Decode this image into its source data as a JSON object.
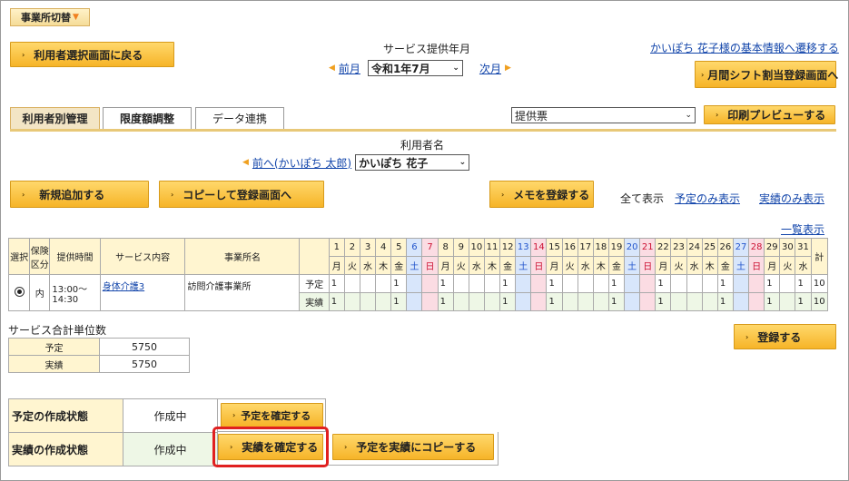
{
  "top": {
    "office_switch": "事業所切替"
  },
  "nav": {
    "back_button": "利用者選択画面に戻る",
    "year_month_label": "サービス提供年月",
    "prev_month": "前月",
    "next_month": "次月",
    "selected_month": "令和1年7月",
    "basic_info_link": "かいぽち 花子様の基本情報へ遷移する",
    "shift_button": "月間シフト割当登録画面へ"
  },
  "tabs": [
    {
      "label": "利用者別管理"
    },
    {
      "label": "限度額調整"
    },
    {
      "label": "データ連携"
    }
  ],
  "print": {
    "selected": "提供票",
    "preview_button": "印刷プレビューする"
  },
  "user": {
    "label": "利用者名",
    "prev_link": "前へ(かいぽち 太郎)",
    "selected": "かいぽち 花子"
  },
  "actions": {
    "new_button": "新規追加する",
    "copy_button": "コピーして登録画面へ",
    "memo_button": "メモを登録する",
    "show_all": "全て表示",
    "show_plan": "予定のみ表示",
    "show_actual": "実績のみ表示",
    "list_link": "一覧表示"
  },
  "table": {
    "headers": {
      "select": "選択",
      "insurance": "保険区分",
      "time": "提供時間",
      "service": "サービス内容",
      "office": "事業所名",
      "total": "計"
    },
    "days": [
      "1",
      "2",
      "3",
      "4",
      "5",
      "6",
      "7",
      "8",
      "9",
      "10",
      "11",
      "12",
      "13",
      "14",
      "15",
      "16",
      "17",
      "18",
      "19",
      "20",
      "21",
      "22",
      "23",
      "24",
      "25",
      "26",
      "27",
      "28",
      "29",
      "30",
      "31"
    ],
    "weekdays": [
      "月",
      "火",
      "水",
      "木",
      "金",
      "土",
      "日",
      "月",
      "火",
      "水",
      "木",
      "金",
      "土",
      "日",
      "月",
      "火",
      "水",
      "木",
      "金",
      "土",
      "日",
      "月",
      "火",
      "水",
      "木",
      "金",
      "土",
      "日",
      "月",
      "火",
      "水"
    ],
    "row": {
      "insurance": "内",
      "time": "13:00〜 14:30",
      "service": "身体介護3",
      "office": "訪問介護事業所",
      "plan_label": "予定",
      "actual_label": "実績",
      "plan": [
        "1",
        "",
        "",
        "",
        "1",
        "",
        "",
        "1",
        "",
        "",
        "",
        "1",
        "",
        "",
        "1",
        "",
        "",
        "",
        "1",
        "",
        "",
        "1",
        "",
        "",
        "",
        "1",
        "",
        "",
        "1",
        "",
        "1"
      ],
      "actual": [
        "1",
        "",
        "",
        "",
        "1",
        "",
        "",
        "1",
        "",
        "",
        "",
        "1",
        "",
        "",
        "1",
        "",
        "",
        "",
        "1",
        "",
        "",
        "1",
        "",
        "",
        "",
        "1",
        "",
        "",
        "1",
        "",
        "1"
      ],
      "plan_total": "10",
      "actual_total": "10"
    }
  },
  "summary": {
    "title": "サービス合計単位数",
    "plan_label": "予定",
    "plan_value": "5750",
    "actual_label": "実績",
    "actual_value": "5750"
  },
  "register_button": "登録する",
  "status": {
    "plan_label": "予定の作成状態",
    "plan_value": "作成中",
    "plan_button": "予定を確定する",
    "actual_label": "実績の作成状態",
    "actual_value": "作成中",
    "actual_button": "実績を確定する",
    "copy_button": "予定を実績にコピーする"
  },
  "colors": {
    "button": "#f6b428",
    "highlight": "#e02020",
    "link": "#1144aa",
    "saturday": "#d8e6fb",
    "sunday": "#fbdce3"
  }
}
